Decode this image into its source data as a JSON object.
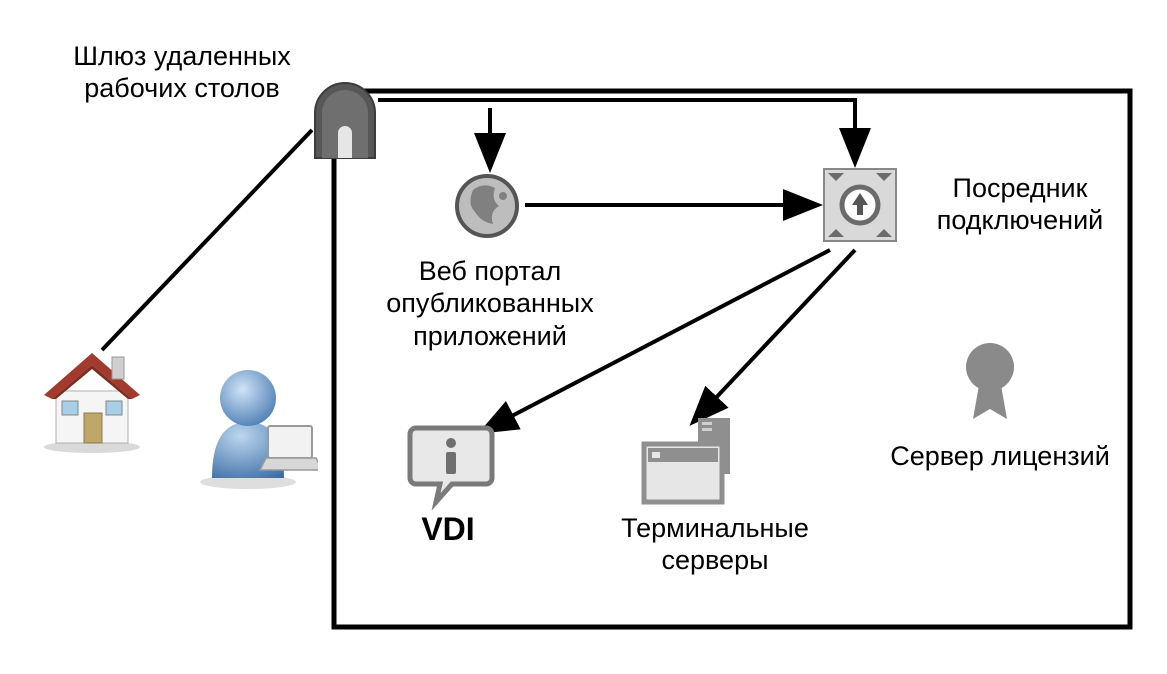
{
  "labels": {
    "gateway": "Шлюз удаленных\nрабочих столов",
    "web_portal": "Веб портал\nопубликованных\nприложений",
    "broker": "Посредник\nподключений",
    "vdi": "VDI",
    "terminal": "Терминальные\nсерверы",
    "license": "Сервер лицензий"
  }
}
